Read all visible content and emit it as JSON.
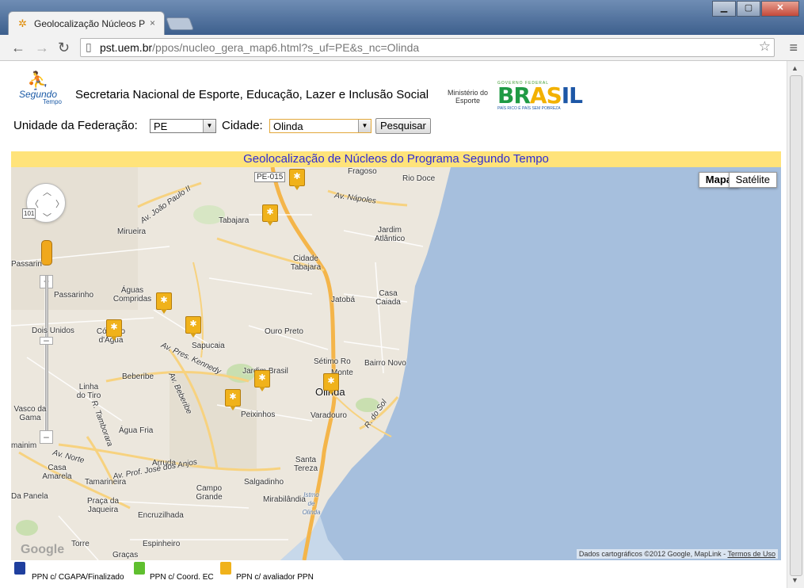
{
  "browser": {
    "tab_title": "Geolocalização Núcleos PS",
    "tab_close": "×",
    "url_domain": "pst.uem.br",
    "url_path": "/ppos/nucleo_gera_map6.html?s_uf=PE&s_nc=Olinda"
  },
  "header": {
    "logo_text": "Segundo",
    "logo_sub": "Tempo",
    "title": "Secretaria Nacional de Esporte, Educação, Lazer e Inclusão Social",
    "ministry_line1": "Ministério do",
    "ministry_line2": "Esporte",
    "gov_line": "GOVERNO FEDERAL",
    "brasil_word": [
      "BR",
      "AS",
      "IL"
    ],
    "brasil_slogan": "PAÍS RICO É PAÍS SEM POBREZA"
  },
  "form": {
    "uf_label": "Unidade da Federação:",
    "uf_value": "PE",
    "city_label": "Cidade:",
    "city_value": "Olinda",
    "search_button": "Pesquisar"
  },
  "banner": "Geolocalização de Núcleos do Programa Segundo Tempo",
  "map": {
    "type_map": "Mapa",
    "type_satellite": "Satélite",
    "attribution": "Dados cartográficos ©2012 Google, MapLink - ",
    "terms": "Termos de Uso",
    "google": "Google",
    "places": {
      "pe015": "PE-015",
      "fragoso": "Fragoso",
      "rio_doce": "Rio Doce",
      "av_napoles": "Av. Nápoles",
      "av_joao_paulo": "Av. João Paulo II",
      "tabajara": "Tabajara",
      "mirueira": "Mirueira",
      "jardim_atlantico": "Jardim Atlântico",
      "cidade_tabajara": "Cidade Tabajara",
      "passarinho": "Passarinho",
      "passarin": "Passarin",
      "aguas_compridas": "Águas Compridas",
      "jatoba": "Jatobá",
      "casa_caiada": "Casa Caiada",
      "dois_unidos": "Dois Unidos",
      "corrego": "Córrego d'Água",
      "ouro_preto": "Ouro Preto",
      "sapucaia": "Sapucaia",
      "setimo_ro": "Sétimo Ro",
      "bairro_novo": "Bairro Novo",
      "beberibe": "Beberibe",
      "av_kennedy": "Av. Pres. Kennedy",
      "jardim_brasil": "Jardim Brasil",
      "monte": "Monte",
      "olinda": "Olinda",
      "linha_tiro": "Linha do Tiro",
      "av_beberibe": "Av. Beberibe",
      "peixinhos": "Peixinhos",
      "varadouro": "Varadouro",
      "r_do_sol": "R. do Sol",
      "vasco_gama": "Vasco da Gama",
      "r_tamborara": "R. Tamborara",
      "agua_fria": "Água Fria",
      "mainim": "mainim",
      "av_norte": "Av. Norte",
      "arruda": "Arruda",
      "santa_tereza": "Santa Tereza",
      "casa_amarela": "Casa Amarela",
      "tamarineira": "Tamarineira",
      "av_prof": "Av. Prof. José dos Anjos",
      "salgadinho": "Salgadinho",
      "da_panela": "Da Panela",
      "praca_jaqueira": "Praça da Jaqueira",
      "campo_grande": "Campo Grande",
      "mirabilandia": "Mirabilândia",
      "istmo": "Istmo de Olinda",
      "encruzilhada": "Encruzilhada",
      "torre": "Torre",
      "espinheiro": "Espinheiro",
      "gracas": "Graças",
      "r101": "101"
    }
  },
  "legend": [
    {
      "label": "PPN c/ CGAPA/Finalizado",
      "color": "#1f3f9e"
    },
    {
      "label": "PPN c/ Coord. EC",
      "color": "#5fbf2f"
    },
    {
      "label": "PPN c/ avaliador PPN",
      "color": "#f0b21b"
    }
  ]
}
